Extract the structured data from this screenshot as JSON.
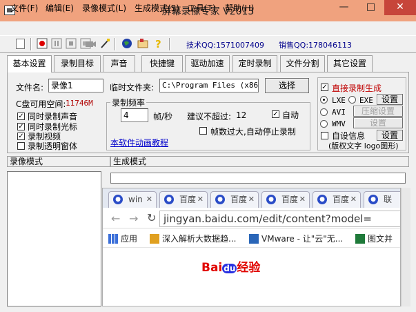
{
  "window": {
    "title": "屏幕录像专家 V2013",
    "min_label": "—",
    "max_label": "□",
    "close_label": "✕"
  },
  "menu": [
    "文件(F)",
    "编辑(E)",
    "录像模式(L)",
    "生成模式(S)",
    "工具(T)",
    "帮助(H)"
  ],
  "toolbar": {
    "tech_qq": "技术QQ:1571007409",
    "sales_qq": "销售QQ:178046113"
  },
  "tabs": [
    "基本设置",
    "录制目标",
    "声音",
    "快捷键",
    "驱动加速",
    "定时录制",
    "文件分割",
    "其它设置"
  ],
  "basic": {
    "filename_label": "文件名:",
    "filename_value": "录像1",
    "tempdir_label": "临时文件夹:",
    "tempdir_value": "C:\\Program Files (x86)\\",
    "select_button": "选择",
    "disk_label": "C盘可用空间:",
    "disk_value": "11746M",
    "checks": [
      {
        "label": "同时录制声音",
        "checked": true
      },
      {
        "label": "同时录制光标",
        "checked": true
      },
      {
        "label": "录制视频",
        "checked": true
      },
      {
        "label": "录制透明窗体",
        "checked": false
      }
    ],
    "fps_group": "录制频率",
    "fps_value": "4",
    "fps_unit": "帧/秒",
    "suggest_label": "建议不超过:",
    "suggest_value": "12",
    "auto_label": "自动",
    "auto_checked": true,
    "stop_label": "帧数过大,自动停止录制",
    "stop_checked": false,
    "tutorial_link": "本软件动画教程"
  },
  "gen": {
    "direct_label": "直接录制生成",
    "direct_checked": true,
    "lxe": "LXE",
    "exe": "EXE",
    "avi": "AVI",
    "wmv": "WMV",
    "setting": "设置",
    "compress_setting": "压缩设置",
    "info_label": "自设信息",
    "info_desc": "(版权文字 logo图形)"
  },
  "sections": {
    "record_mode": "录像模式",
    "gen_mode": "生成模式"
  },
  "browser": {
    "tabs": [
      "win",
      "百度",
      "百度",
      "百度",
      "百度",
      "百度",
      "联"
    ],
    "url": "jingyan.baidu.com/edit/content?model=",
    "bookmarks": [
      "应用",
      "深入解析大数据趋...",
      "VMware - 让\"云\"无...",
      "图文并"
    ],
    "logo_bai": "Bai",
    "logo_du": "du",
    "logo_jy": "经验"
  }
}
